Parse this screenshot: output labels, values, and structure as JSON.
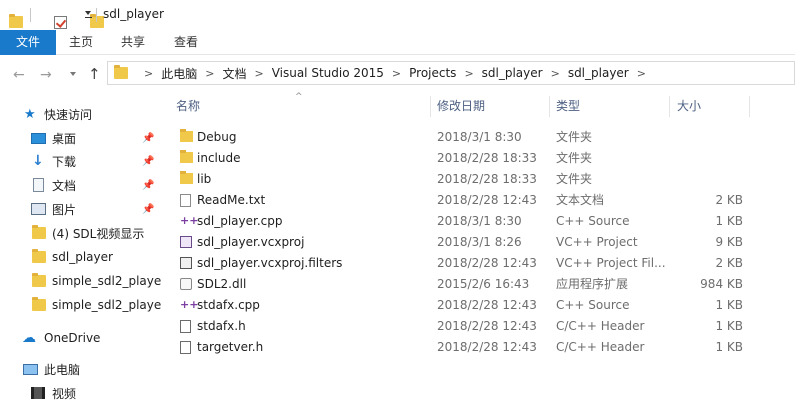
{
  "window": {
    "title": "sdl_player"
  },
  "ribbon": {
    "tabs": [
      "文件",
      "主页",
      "共享",
      "查看"
    ]
  },
  "address": {
    "crumbs": [
      "此电脑",
      "文档",
      "Visual Studio 2015",
      "Projects",
      "sdl_player",
      "sdl_player"
    ],
    "separator": ">"
  },
  "nav": {
    "back": "←",
    "forward": "→",
    "up": "↑"
  },
  "sidebar": {
    "quick_access": "快速访问",
    "pinned": [
      {
        "label": "桌面",
        "icon": "desktop-icon"
      },
      {
        "label": "下载",
        "icon": "download-icon"
      },
      {
        "label": "文档",
        "icon": "documents-icon"
      },
      {
        "label": "图片",
        "icon": "pictures-icon"
      }
    ],
    "recent": [
      "(4) SDL视频显示",
      "sdl_player",
      "simple_sdl2_playe",
      "simple_sdl2_playe"
    ],
    "onedrive": "OneDrive",
    "this_pc": "此电脑",
    "videos": "视频",
    "pin_glyph": "📌"
  },
  "columns": {
    "name": "名称",
    "date": "修改日期",
    "type": "类型",
    "size": "大小",
    "sort_glyph": "^"
  },
  "files": [
    {
      "name": "Debug",
      "date": "2018/3/1 8:30",
      "type": "文件夹",
      "size": "",
      "icon": "folder"
    },
    {
      "name": "include",
      "date": "2018/2/28 18:33",
      "type": "文件夹",
      "size": "",
      "icon": "folder"
    },
    {
      "name": "lib",
      "date": "2018/2/28 18:33",
      "type": "文件夹",
      "size": "",
      "icon": "folder"
    },
    {
      "name": "ReadMe.txt",
      "date": "2018/2/28 12:43",
      "type": "文本文档",
      "size": "2 KB",
      "icon": "txt"
    },
    {
      "name": "sdl_player.cpp",
      "date": "2018/3/1 8:30",
      "type": "C++ Source",
      "size": "1 KB",
      "icon": "cpp"
    },
    {
      "name": "sdl_player.vcxproj",
      "date": "2018/3/1 8:26",
      "type": "VC++ Project",
      "size": "9 KB",
      "icon": "proj"
    },
    {
      "name": "sdl_player.vcxproj.filters",
      "date": "2018/2/28 12:43",
      "type": "VC++ Project Fil...",
      "size": "2 KB",
      "icon": "filters"
    },
    {
      "name": "SDL2.dll",
      "date": "2015/2/6 16:43",
      "type": "应用程序扩展",
      "size": "984 KB",
      "icon": "dll"
    },
    {
      "name": "stdafx.cpp",
      "date": "2018/2/28 12:43",
      "type": "C++ Source",
      "size": "1 KB",
      "icon": "cpp"
    },
    {
      "name": "stdafx.h",
      "date": "2018/2/28 12:43",
      "type": "C/C++ Header",
      "size": "1 KB",
      "icon": "h"
    },
    {
      "name": "targetver.h",
      "date": "2018/2/28 12:43",
      "type": "C/C++ Header",
      "size": "1 KB",
      "icon": "h"
    }
  ],
  "colors": {
    "accent": "#1979ca",
    "folder": "#f0c84a",
    "header_text": "#4d6082"
  }
}
